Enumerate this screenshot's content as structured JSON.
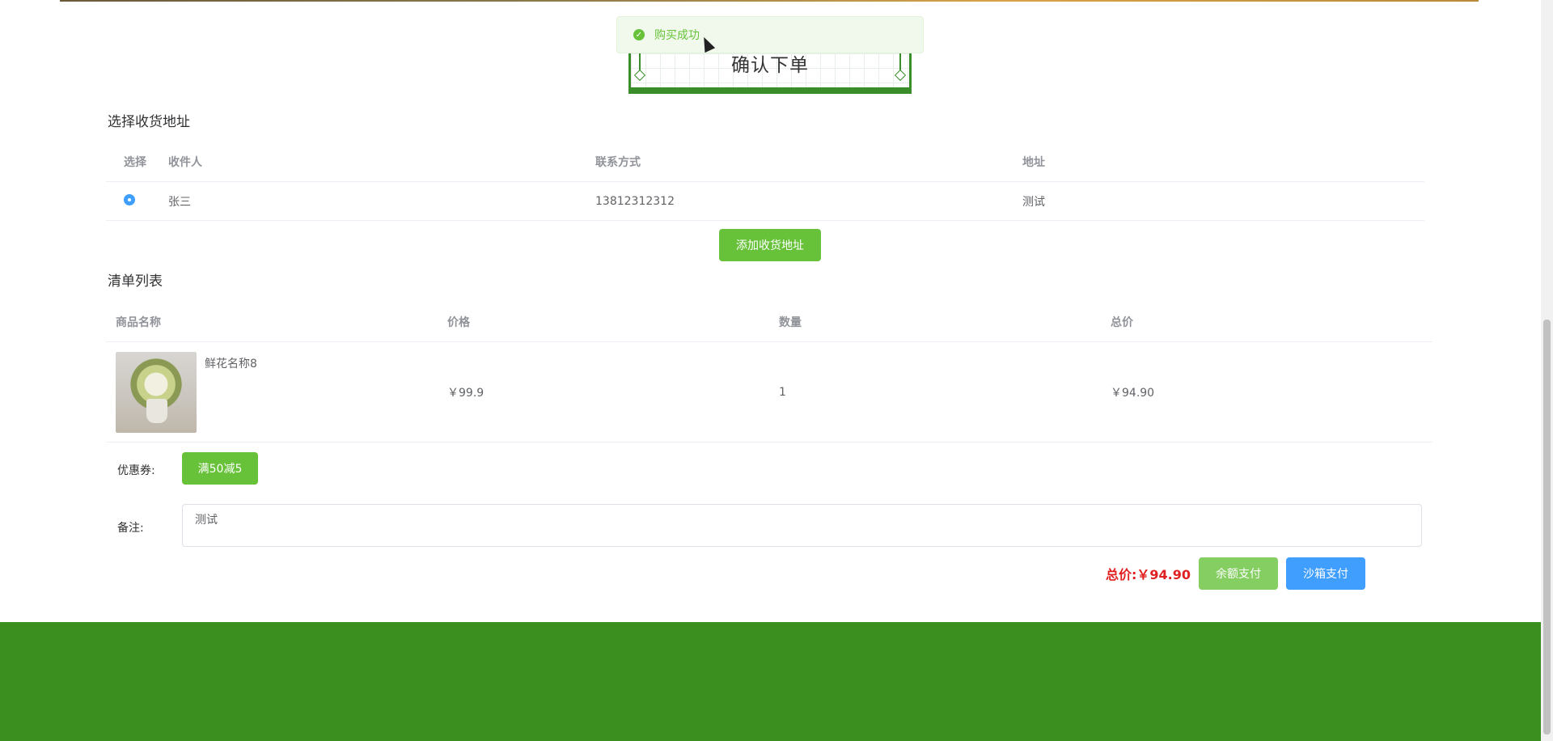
{
  "toast": {
    "message": "购买成功"
  },
  "page_title": "确认下单",
  "address_section": {
    "title": "选择收货地址",
    "columns": [
      "选择",
      "收件人",
      "联系方式",
      "地址"
    ],
    "rows": [
      {
        "name": "张三",
        "phone": "13812312312",
        "address": "测试"
      }
    ],
    "add_button": "添加收货地址"
  },
  "order_section": {
    "title": "清单列表",
    "columns": [
      "商品名称",
      "价格",
      "数量",
      "总价"
    ],
    "rows": [
      {
        "name": "鲜花名称8",
        "price": "￥99.9",
        "quantity": "1",
        "total": "￥94.90"
      }
    ]
  },
  "coupon": {
    "label": "优惠券:",
    "button": "满50减5"
  },
  "remark": {
    "label": "备注:",
    "value": "测试"
  },
  "summary": {
    "total_label": "总价:",
    "total_value": "￥94.90",
    "balance_pay": "余额支付",
    "sandbox_pay": "沙箱支付"
  },
  "colors": {
    "primary_green": "#67c23a",
    "footer_green": "#3a8f1f",
    "blue": "#409eff",
    "price_red": "#e02020"
  }
}
